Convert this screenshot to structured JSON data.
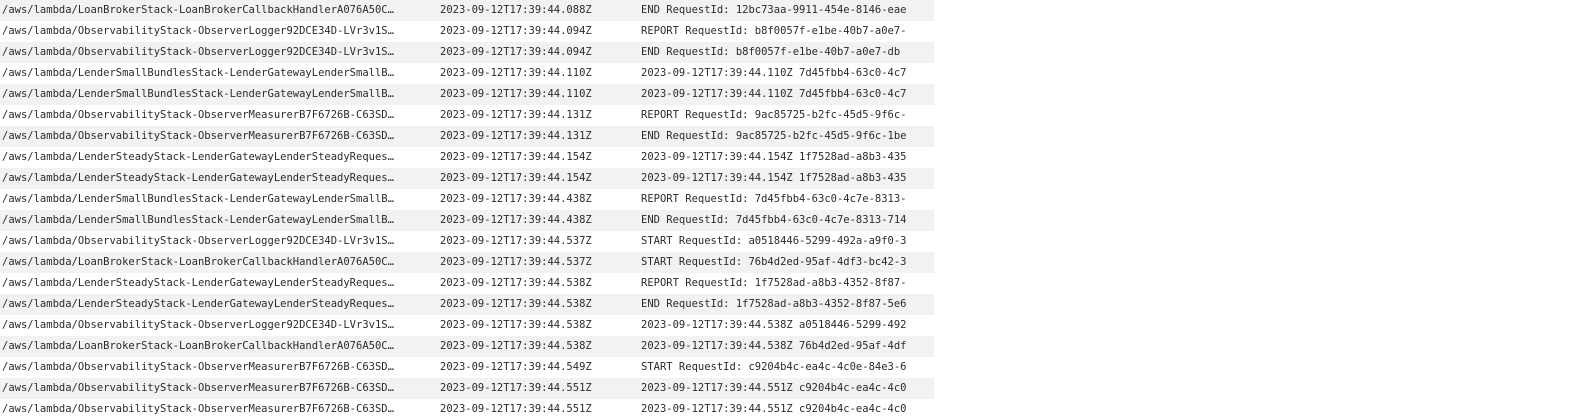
{
  "logs": {
    "rows": [
      {
        "group": "/aws/lambda/LoanBrokerStack-LoanBrokerCallbackHandlerA076A50C…",
        "timestamp": "2023-09-12T17:39:44.088Z",
        "message": "END RequestId: 12bc73aa-9911-454e-8146-eae"
      },
      {
        "group": "/aws/lambda/ObservabilityStack-ObserverLogger92DCE34D-LVr3v1S…",
        "timestamp": "2023-09-12T17:39:44.094Z",
        "message": "REPORT RequestId: b8f0057f-e1be-40b7-a0e7-"
      },
      {
        "group": "/aws/lambda/ObservabilityStack-ObserverLogger92DCE34D-LVr3v1S…",
        "timestamp": "2023-09-12T17:39:44.094Z",
        "message": "END RequestId: b8f0057f-e1be-40b7-a0e7-db"
      },
      {
        "group": "/aws/lambda/LenderSmallBundlesStack-LenderGatewayLenderSmallB…",
        "timestamp": "2023-09-12T17:39:44.110Z",
        "message": "2023-09-12T17:39:44.110Z 7d45fbb4-63c0-4c7"
      },
      {
        "group": "/aws/lambda/LenderSmallBundlesStack-LenderGatewayLenderSmallB…",
        "timestamp": "2023-09-12T17:39:44.110Z",
        "message": "2023-09-12T17:39:44.110Z 7d45fbb4-63c0-4c7"
      },
      {
        "group": "/aws/lambda/ObservabilityStack-ObserverMeasurerB7F6726B-C63SD…",
        "timestamp": "2023-09-12T17:39:44.131Z",
        "message": "REPORT RequestId: 9ac85725-b2fc-45d5-9f6c-"
      },
      {
        "group": "/aws/lambda/ObservabilityStack-ObserverMeasurerB7F6726B-C63SD…",
        "timestamp": "2023-09-12T17:39:44.131Z",
        "message": "END RequestId: 9ac85725-b2fc-45d5-9f6c-1be"
      },
      {
        "group": "/aws/lambda/LenderSteadyStack-LenderGatewayLenderSteadyReques…",
        "timestamp": "2023-09-12T17:39:44.154Z",
        "message": "2023-09-12T17:39:44.154Z 1f7528ad-a8b3-435"
      },
      {
        "group": "/aws/lambda/LenderSteadyStack-LenderGatewayLenderSteadyReques…",
        "timestamp": "2023-09-12T17:39:44.154Z",
        "message": "2023-09-12T17:39:44.154Z 1f7528ad-a8b3-435"
      },
      {
        "group": "/aws/lambda/LenderSmallBundlesStack-LenderGatewayLenderSmallB…",
        "timestamp": "2023-09-12T17:39:44.438Z",
        "message": "REPORT RequestId: 7d45fbb4-63c0-4c7e-8313-"
      },
      {
        "group": "/aws/lambda/LenderSmallBundlesStack-LenderGatewayLenderSmallB…",
        "timestamp": "2023-09-12T17:39:44.438Z",
        "message": "END RequestId: 7d45fbb4-63c0-4c7e-8313-714"
      },
      {
        "group": "/aws/lambda/ObservabilityStack-ObserverLogger92DCE34D-LVr3v1S…",
        "timestamp": "2023-09-12T17:39:44.537Z",
        "message": "START RequestId: a0518446-5299-492a-a9f0-3"
      },
      {
        "group": "/aws/lambda/LoanBrokerStack-LoanBrokerCallbackHandlerA076A50C…",
        "timestamp": "2023-09-12T17:39:44.537Z",
        "message": "START RequestId: 76b4d2ed-95af-4df3-bc42-3"
      },
      {
        "group": "/aws/lambda/LenderSteadyStack-LenderGatewayLenderSteadyReques…",
        "timestamp": "2023-09-12T17:39:44.538Z",
        "message": "REPORT RequestId: 1f7528ad-a8b3-4352-8f87-"
      },
      {
        "group": "/aws/lambda/LenderSteadyStack-LenderGatewayLenderSteadyReques…",
        "timestamp": "2023-09-12T17:39:44.538Z",
        "message": "END RequestId: 1f7528ad-a8b3-4352-8f87-5e6"
      },
      {
        "group": "/aws/lambda/ObservabilityStack-ObserverLogger92DCE34D-LVr3v1S…",
        "timestamp": "2023-09-12T17:39:44.538Z",
        "message": "2023-09-12T17:39:44.538Z a0518446-5299-492"
      },
      {
        "group": "/aws/lambda/LoanBrokerStack-LoanBrokerCallbackHandlerA076A50C…",
        "timestamp": "2023-09-12T17:39:44.538Z",
        "message": "2023-09-12T17:39:44.538Z 76b4d2ed-95af-4df"
      },
      {
        "group": "/aws/lambda/ObservabilityStack-ObserverMeasurerB7F6726B-C63SD…",
        "timestamp": "2023-09-12T17:39:44.549Z",
        "message": "START RequestId: c9204b4c-ea4c-4c0e-84e3-6"
      },
      {
        "group": "/aws/lambda/ObservabilityStack-ObserverMeasurerB7F6726B-C63SD…",
        "timestamp": "2023-09-12T17:39:44.551Z",
        "message": "2023-09-12T17:39:44.551Z c9204b4c-ea4c-4c0"
      },
      {
        "group": "/aws/lambda/ObservabilityStack-ObserverMeasurerB7F6726B-C63SD…",
        "timestamp": "2023-09-12T17:39:44.551Z",
        "message": "2023-09-12T17:39:44.551Z c9204b4c-ea4c-4c0"
      }
    ]
  }
}
